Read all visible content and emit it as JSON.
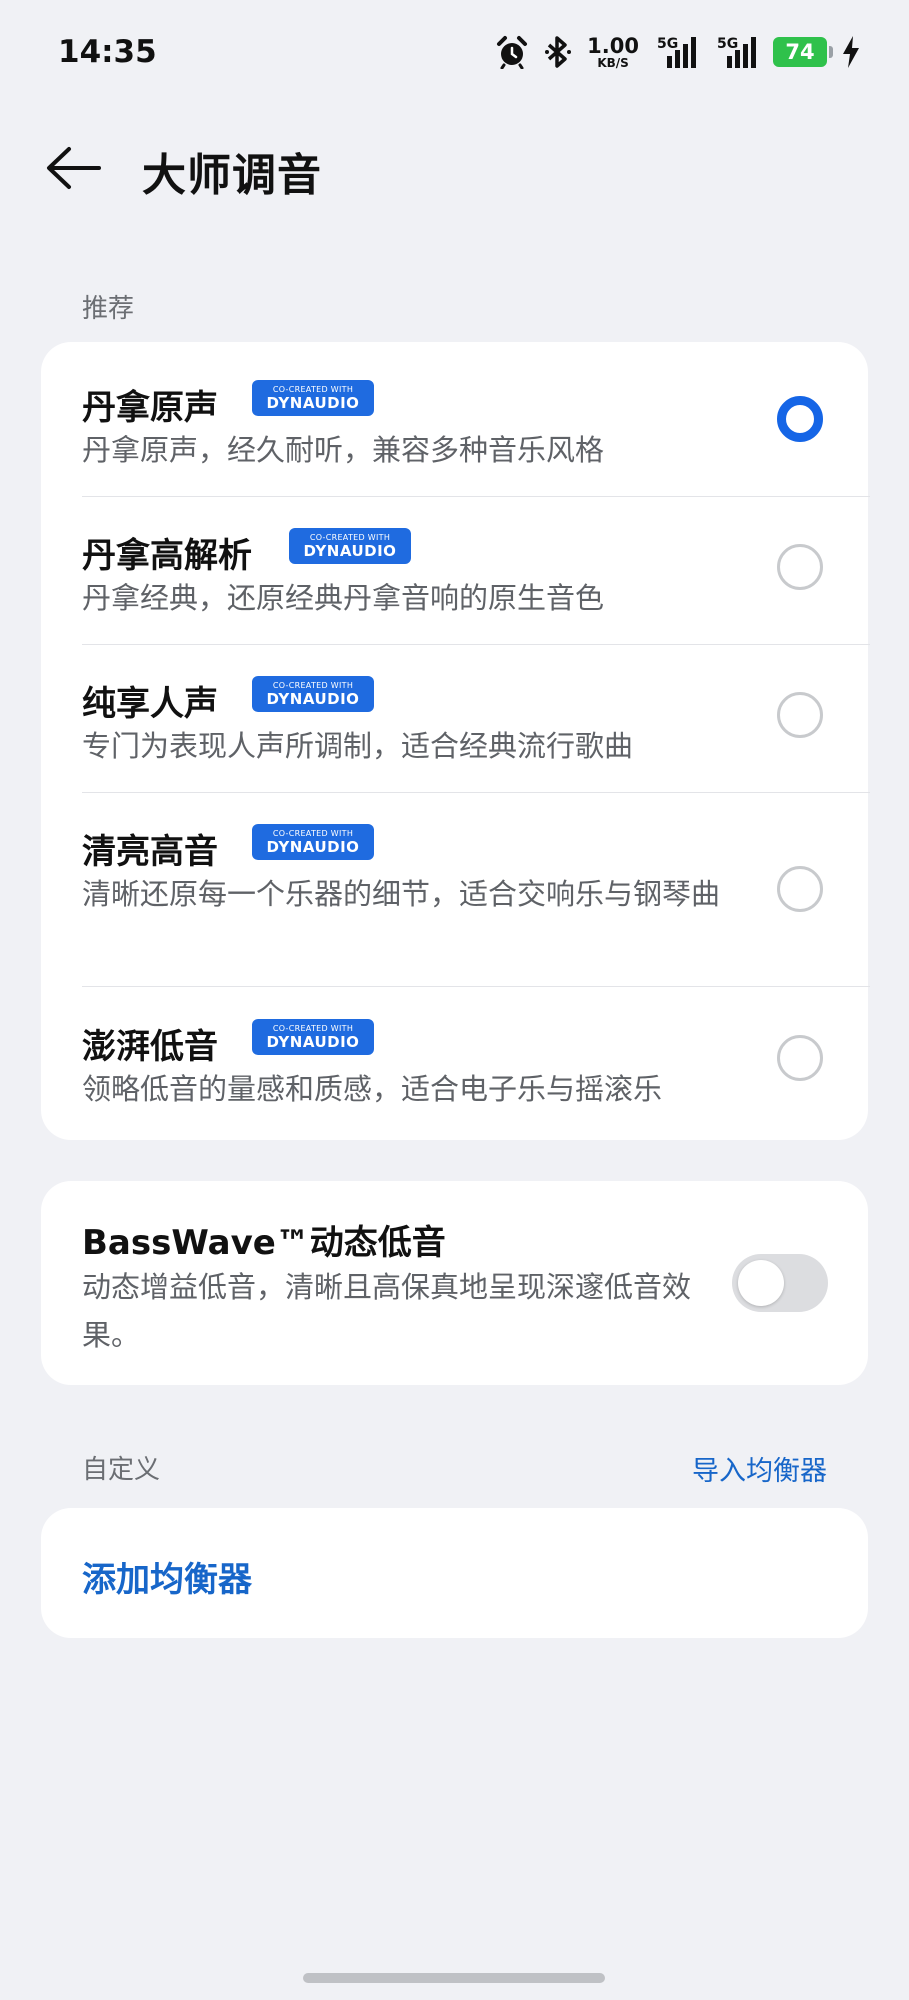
{
  "status_bar": {
    "time": "14:35",
    "net_speed_value": "1.00",
    "net_speed_unit": "KB/S",
    "signal_1_label": "5G",
    "signal_2_label": "5G",
    "battery_level": "74",
    "icons": [
      "alarm-icon",
      "bluetooth-icon",
      "signal-icon",
      "signal-icon",
      "battery-icon",
      "charging-icon"
    ]
  },
  "header": {
    "back_icon": "back-arrow-icon",
    "title": "大师调音"
  },
  "recommended": {
    "section_label": "推荐",
    "badge": {
      "top": "CO-CREATED WITH",
      "main": "DYNAUDIO",
      "color": "#1f6be0"
    },
    "items": [
      {
        "title": "丹拿原声",
        "desc": "丹拿原声，经久耐听，兼容多种音乐风格",
        "selected": true
      },
      {
        "title": "丹拿高解析",
        "desc": "丹拿经典，还原经典丹拿音响的原生音色",
        "selected": false
      },
      {
        "title": "纯享人声",
        "desc": "专门为表现人声所调制，适合经典流行歌曲",
        "selected": false
      },
      {
        "title": "清亮高音",
        "desc": "清晰还原每一个乐器的细节，适合交响乐与钢琴曲",
        "selected": false
      },
      {
        "title": "澎湃低音",
        "desc": "领略低音的量感和质感，适合电子乐与摇滚乐",
        "selected": false
      }
    ]
  },
  "basswave": {
    "title": "BassWave™动态低音",
    "desc": "动态增益低音，清晰且高保真地呈现深邃低音效果。",
    "enabled": false
  },
  "custom": {
    "section_label": "自定义",
    "import_link": "导入均衡器",
    "add_label": "添加均衡器"
  },
  "colors": {
    "accent": "#1565e6",
    "link": "#1766c9",
    "background": "#f0f1f5",
    "battery": "#2fc14b"
  }
}
